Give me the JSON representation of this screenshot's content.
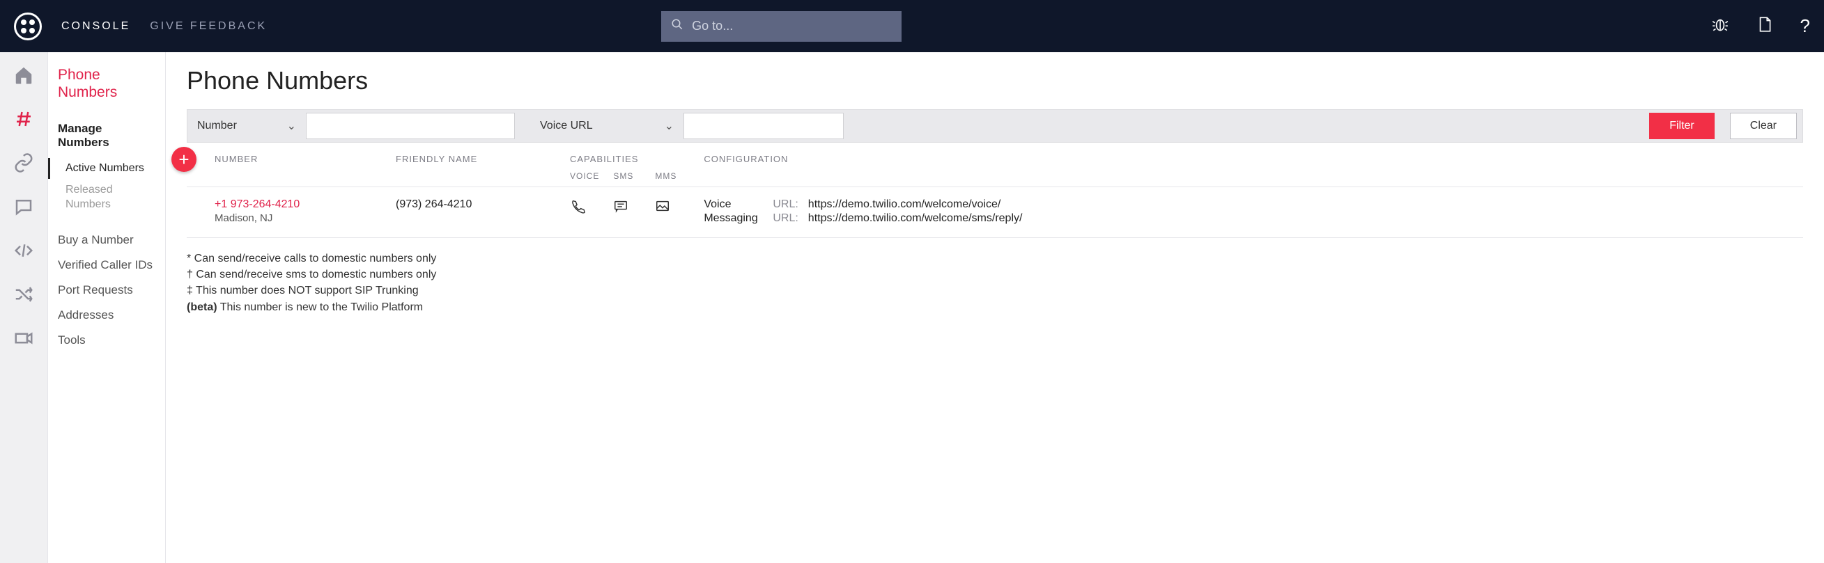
{
  "topbar": {
    "console": "CONSOLE",
    "feedback": "GIVE FEEDBACK",
    "search_placeholder": "Go to..."
  },
  "sidebar": {
    "title_line1": "Phone",
    "title_line2": "Numbers",
    "manage_label": "Manage Numbers",
    "active_label": "Active Numbers",
    "released_label": "Released Numbers",
    "links": {
      "buy": "Buy a Number",
      "verified": "Verified Caller IDs",
      "port": "Port Requests",
      "addresses": "Addresses",
      "tools": "Tools"
    }
  },
  "main": {
    "page_title": "Phone Numbers",
    "filter": {
      "left_select": "Number",
      "right_select": "Voice URL",
      "filter_btn": "Filter",
      "clear_btn": "Clear"
    },
    "columns": {
      "number": "NUMBER",
      "friendly": "FRIENDLY NAME",
      "capabilities": "CAPABILITIES",
      "voice": "VOICE",
      "sms": "SMS",
      "mms": "MMS",
      "config": "CONFIGURATION"
    },
    "rows": [
      {
        "number": "+1 973-264-4210",
        "location": "Madison, NJ",
        "friendly": "(973) 264-4210",
        "config": {
          "voice_label": "Voice",
          "voice_url_label": "URL:",
          "voice_url": "https://demo.twilio.com/welcome/voice/",
          "msg_label": "Messaging",
          "msg_url_label": "URL:",
          "msg_url": "https://demo.twilio.com/welcome/sms/reply/"
        }
      }
    ],
    "footnotes": {
      "f1": "* Can send/receive calls to domestic numbers only",
      "f2": "† Can send/receive sms to domestic numbers only",
      "f3": "‡ This number does NOT support SIP Trunking",
      "beta_label": "(beta)",
      "beta_text": " This number is new to the Twilio Platform"
    }
  }
}
